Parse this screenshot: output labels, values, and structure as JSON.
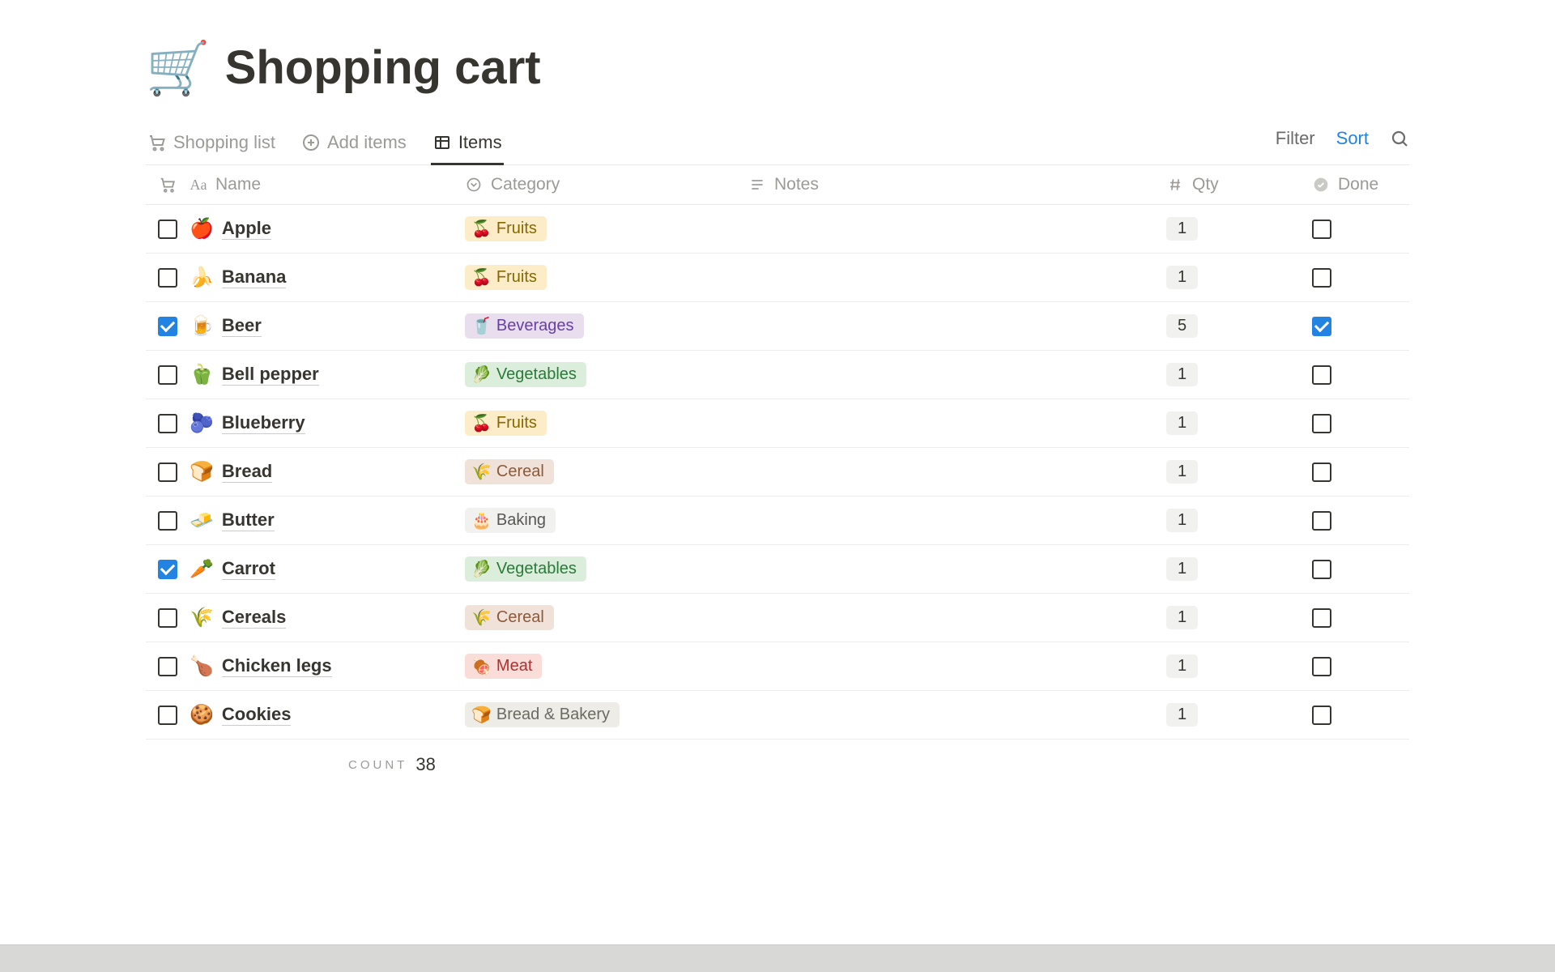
{
  "header": {
    "icon": "🛒",
    "title": "Shopping cart"
  },
  "tabs": [
    {
      "id": "shopping-list",
      "label": "Shopping list",
      "icon": "cart"
    },
    {
      "id": "add-items",
      "label": "Add items",
      "icon": "plus-circle"
    },
    {
      "id": "items",
      "label": "Items",
      "icon": "table",
      "active": true
    }
  ],
  "toolbar": {
    "filter": "Filter",
    "sort": "Sort"
  },
  "columns": {
    "name": "Name",
    "category": "Category",
    "notes": "Notes",
    "qty": "Qty",
    "done": "Done"
  },
  "categories": {
    "fruits": {
      "emoji": "🍒",
      "label": "Fruits",
      "bg": "#fdecc8",
      "fg": "#856a00"
    },
    "beverages": {
      "emoji": "🥤",
      "label": "Beverages",
      "bg": "#e8deee",
      "fg": "#6940a5"
    },
    "vegetables": {
      "emoji": "🥬",
      "label": "Vegetables",
      "bg": "#dbeddb",
      "fg": "#2b7a3a"
    },
    "cereal": {
      "emoji": "🌾",
      "label": "Cereal",
      "bg": "#f1e2d9",
      "fg": "#8a5a3a"
    },
    "baking": {
      "emoji": "🎂",
      "label": "Baking",
      "bg": "#f1f1ef",
      "fg": "#595753"
    },
    "meat": {
      "emoji": "🍖",
      "label": "Meat",
      "bg": "#fadcd9",
      "fg": "#b03030"
    },
    "bread_bakery": {
      "emoji": "🍞",
      "label": "Bread & Bakery",
      "bg": "#eeece6",
      "fg": "#6b6a63"
    }
  },
  "rows": [
    {
      "selected": false,
      "emoji": "🍎",
      "name": "Apple",
      "cat": "fruits",
      "qty": 1,
      "done": false
    },
    {
      "selected": false,
      "emoji": "🍌",
      "name": "Banana",
      "cat": "fruits",
      "qty": 1,
      "done": false
    },
    {
      "selected": true,
      "emoji": "🍺",
      "name": "Beer",
      "cat": "beverages",
      "qty": 5,
      "done": true
    },
    {
      "selected": false,
      "emoji": "🫑",
      "name": "Bell pepper",
      "cat": "vegetables",
      "qty": 1,
      "done": false
    },
    {
      "selected": false,
      "emoji": "🫐",
      "name": "Blueberry",
      "cat": "fruits",
      "qty": 1,
      "done": false
    },
    {
      "selected": false,
      "emoji": "🍞",
      "name": "Bread",
      "cat": "cereal",
      "qty": 1,
      "done": false
    },
    {
      "selected": false,
      "emoji": "🧈",
      "name": "Butter",
      "cat": "baking",
      "qty": 1,
      "done": false
    },
    {
      "selected": true,
      "emoji": "🥕",
      "name": "Carrot",
      "cat": "vegetables",
      "qty": 1,
      "done": false
    },
    {
      "selected": false,
      "emoji": "🌾",
      "name": "Cereals",
      "cat": "cereal",
      "qty": 1,
      "done": false
    },
    {
      "selected": false,
      "emoji": "🍗",
      "name": "Chicken legs",
      "cat": "meat",
      "qty": 1,
      "done": false
    },
    {
      "selected": false,
      "emoji": "🍪",
      "name": "Cookies",
      "cat": "bread_bakery",
      "qty": 1,
      "done": false
    }
  ],
  "summary": {
    "count_label": "COUNT",
    "count": 38
  }
}
